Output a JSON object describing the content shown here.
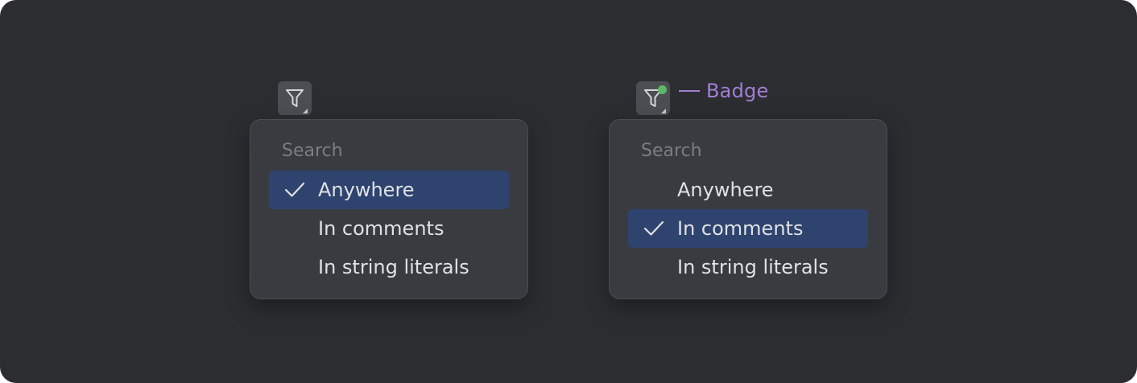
{
  "annotation": {
    "label": "Badge"
  },
  "left_example": {
    "filter_button": {
      "icon": "filter-icon",
      "has_badge": false
    },
    "popup": {
      "header": "Search",
      "items": [
        {
          "label": "Anywhere",
          "checked": true
        },
        {
          "label": "In comments",
          "checked": false
        },
        {
          "label": "In string literals",
          "checked": false
        }
      ]
    }
  },
  "right_example": {
    "filter_button": {
      "icon": "filter-icon",
      "has_badge": true
    },
    "popup": {
      "header": "Search",
      "items": [
        {
          "label": "Anywhere",
          "checked": false
        },
        {
          "label": "In comments",
          "checked": true
        },
        {
          "label": "In string literals",
          "checked": false
        }
      ]
    }
  },
  "colors": {
    "background": "#2b2d30",
    "popup_background": "#393b40",
    "selection": "#2e436e",
    "badge": "#5fb865",
    "annotation": "#a37fd6"
  }
}
